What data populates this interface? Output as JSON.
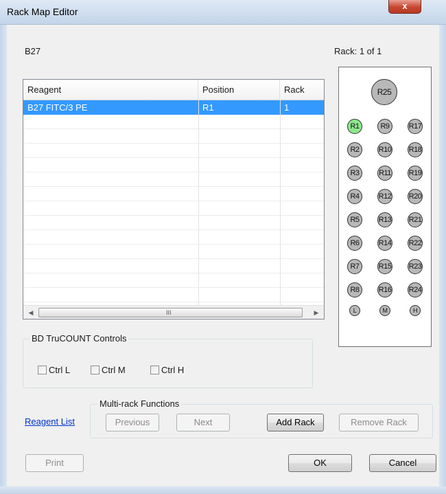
{
  "window": {
    "title": "Rack Map Editor",
    "close_glyph": "x"
  },
  "panel_name": "B27",
  "rack_counter": "Rack:  1 of 1",
  "list": {
    "columns": [
      "Reagent",
      "Position",
      "Rack"
    ],
    "rows": [
      {
        "reagent": "B27 FITC/3 PE",
        "position": "R1",
        "rack": "1"
      }
    ],
    "scroll_grip": "III",
    "scroll_left_arrow": "◀",
    "scroll_right_arrow": "▶"
  },
  "trucount": {
    "label": "BD TruCOUNT Controls",
    "controls": [
      "Ctrl L",
      "Ctrl M",
      "Ctrl H"
    ]
  },
  "reagent_list_link": "Reagent List",
  "multirack": {
    "label": "Multi-rack Functions",
    "previous": "Previous",
    "next": "Next",
    "add_rack": "Add Rack",
    "remove_rack": "Remove Rack"
  },
  "buttons": {
    "print": "Print",
    "ok": "OK",
    "cancel": "Cancel"
  },
  "rack": {
    "top": "R25",
    "positions": [
      [
        "R1",
        "R9",
        "R17"
      ],
      [
        "R2",
        "R10",
        "R18"
      ],
      [
        "R3",
        "R11",
        "R19"
      ],
      [
        "R4",
        "R12",
        "R20"
      ],
      [
        "R5",
        "R13",
        "R21"
      ],
      [
        "R6",
        "R14",
        "R22"
      ],
      [
        "R7",
        "R15",
        "R23"
      ],
      [
        "R8",
        "R16",
        "R24"
      ]
    ],
    "controls": [
      "L",
      "M",
      "H"
    ],
    "occupied": [
      "R1"
    ],
    "occupied_color": "#8ee68e",
    "empty_color": "#b8b8b8"
  }
}
